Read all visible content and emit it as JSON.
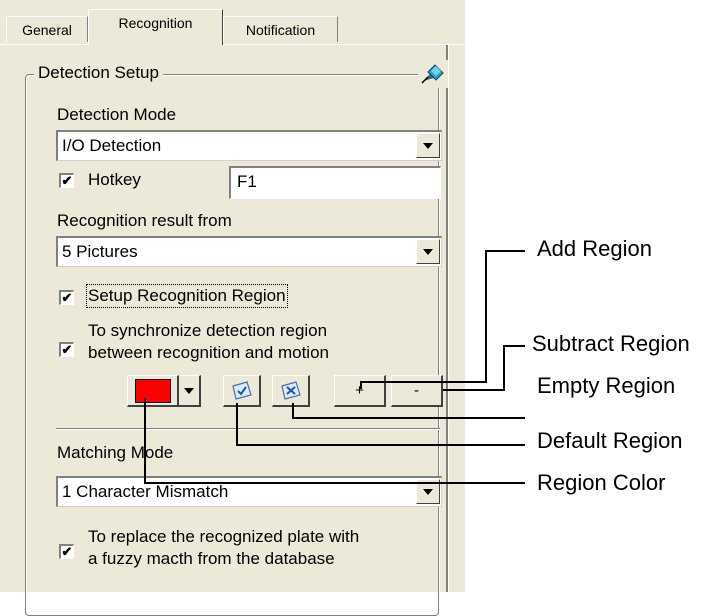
{
  "tabs": [
    {
      "label": "General",
      "active": false
    },
    {
      "label": "Recognition",
      "active": true
    },
    {
      "label": "Notification",
      "active": false
    }
  ],
  "group": {
    "title": "Detection Setup",
    "pin_icon": "pin-icon"
  },
  "detection_mode": {
    "label": "Detection Mode",
    "value": "I/O Detection"
  },
  "hotkey": {
    "label": "Hotkey",
    "checked": true,
    "value": "F1"
  },
  "recognition_result": {
    "label": "Recognition result from",
    "value": "5 Pictures"
  },
  "setup_region": {
    "label": "Setup Recognition Region",
    "checked": true
  },
  "sync": {
    "line1": "To synchronize detection region",
    "line2": "between recognition and motion",
    "checked": true
  },
  "region_buttons": {
    "color": "#ff0000",
    "add": "+",
    "subtract": "-"
  },
  "matching_mode": {
    "label": "Matching Mode",
    "value": "1 Character Mismatch"
  },
  "fuzzy": {
    "line1": "To replace the recognized plate with",
    "line2": "a fuzzy macth from the database",
    "checked": true
  },
  "callouts": {
    "add_region": "Add Region",
    "subtract_region": "Subtract Region",
    "empty_region": "Empty Region",
    "default_region": "Default Region",
    "region_color": "Region Color"
  },
  "check_mark": "✔"
}
